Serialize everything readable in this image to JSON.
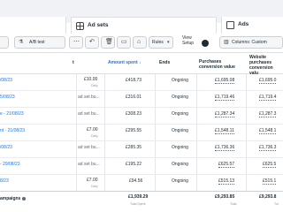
{
  "tabs": {
    "ad_sets": "Ad sets",
    "ads": "Ads"
  },
  "toolbar": {
    "ab_test": "A/B test",
    "rules": "Rules",
    "view_setup": "View Setup",
    "columns": "Columns: Custom"
  },
  "table": {
    "headers": {
      "budget_fragment": "t",
      "amount_spent": "Amount spent ↓",
      "ends": "Ends",
      "purchases_conversion_value": "Purchases conversion value",
      "website_purchases_conversion_value": "Website purchases conversion valu"
    },
    "rows": [
      {
        "name": "/08/23",
        "budget": "£10.00",
        "budget_sub": "Daily",
        "spent": "£418.73",
        "ends": "Ongoing",
        "pcv": "£1,695.08",
        "wpcv": "£1,695.0"
      },
      {
        "name": "5/08/23",
        "budget": "ad set bu...",
        "budget_sub": "",
        "spent": "£316.01",
        "ends": "Ongoing",
        "pcv": "£1,719.46",
        "wpcv": "£1,719.4"
      },
      {
        "name": "e - 21/08/23",
        "budget": "ad set bu...",
        "budget_sub": "",
        "spent": "£308.23",
        "ends": "Ongoing",
        "pcv": "£1,287.34",
        "wpcv": "£1,287.3"
      },
      {
        "name": "nt - 21/08/23",
        "budget": "£7.00",
        "budget_sub": "Daily",
        "spent": "£295.55",
        "ends": "Ongoing",
        "pcv": "£1,548.11",
        "wpcv": "£1,548.1"
      },
      {
        "name": "/08/23",
        "budget": "ad set bu...",
        "budget_sub": "",
        "spent": "£285.35",
        "ends": "Ongoing",
        "pcv": "£1,736.36",
        "wpcv": "£1,736.3"
      },
      {
        "name": "- 29/08/23",
        "budget": "ad set bu...",
        "budget_sub": "",
        "spent": "£195.22",
        "ends": "Ongoing",
        "pcv": "£625.57",
        "wpcv": "£625.5"
      },
      {
        "name": "8/23",
        "budget": "£7.00",
        "budget_sub": "Daily",
        "spent": "£94.56",
        "ends": "Ongoing",
        "pcv": "£515.13",
        "wpcv": "£515.1"
      }
    ],
    "totals": {
      "label": "ampaigns",
      "spent": "£1,939.29",
      "spent_sub": "Total Spent",
      "pcv": "£9,293.85",
      "pcv_sub": "Total",
      "wpcv": "£9,293.8",
      "wpcv_sub": "Tot"
    }
  }
}
